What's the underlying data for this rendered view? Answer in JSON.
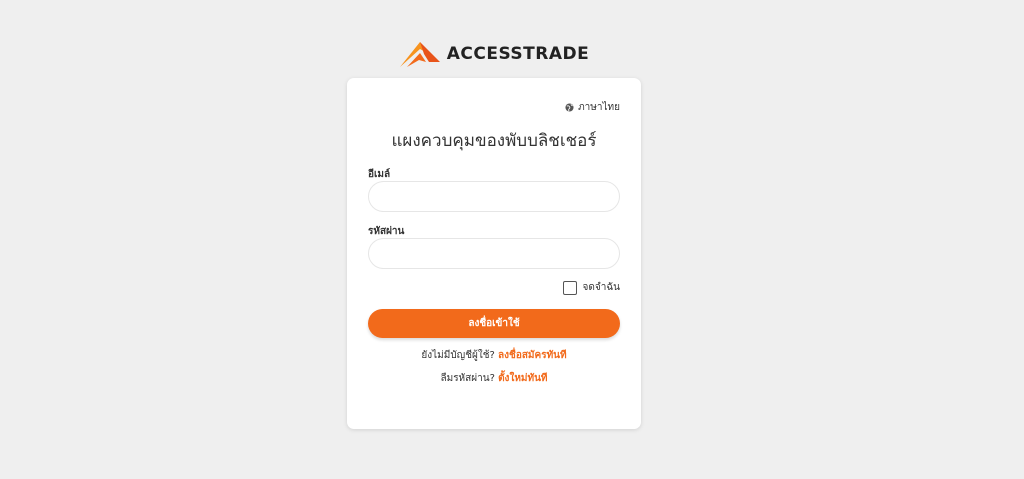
{
  "brand": {
    "name": "ACCESSTRADE",
    "accent_color": "#f26a1b"
  },
  "language": {
    "icon": "globe-icon",
    "label": "ภาษาไทย"
  },
  "form": {
    "title": "แผงควบคุมของพับบลิชเชอร์",
    "email_label": "อีเมล์",
    "email_value": "",
    "email_placeholder": "",
    "password_label": "รหัสผ่าน",
    "password_value": "",
    "password_placeholder": "",
    "remember_label": "จดจำฉัน",
    "remember_checked": false,
    "submit_label": "ลงชื่อเข้าใช้"
  },
  "signup": {
    "prompt": "ยังไม่มีบัญชีผู้ใช้?",
    "link": "ลงชื่อสมัครทันที"
  },
  "reset": {
    "prompt": "ลืมรหัสผ่าน?",
    "link": "ตั้งใหม่ทันที"
  }
}
